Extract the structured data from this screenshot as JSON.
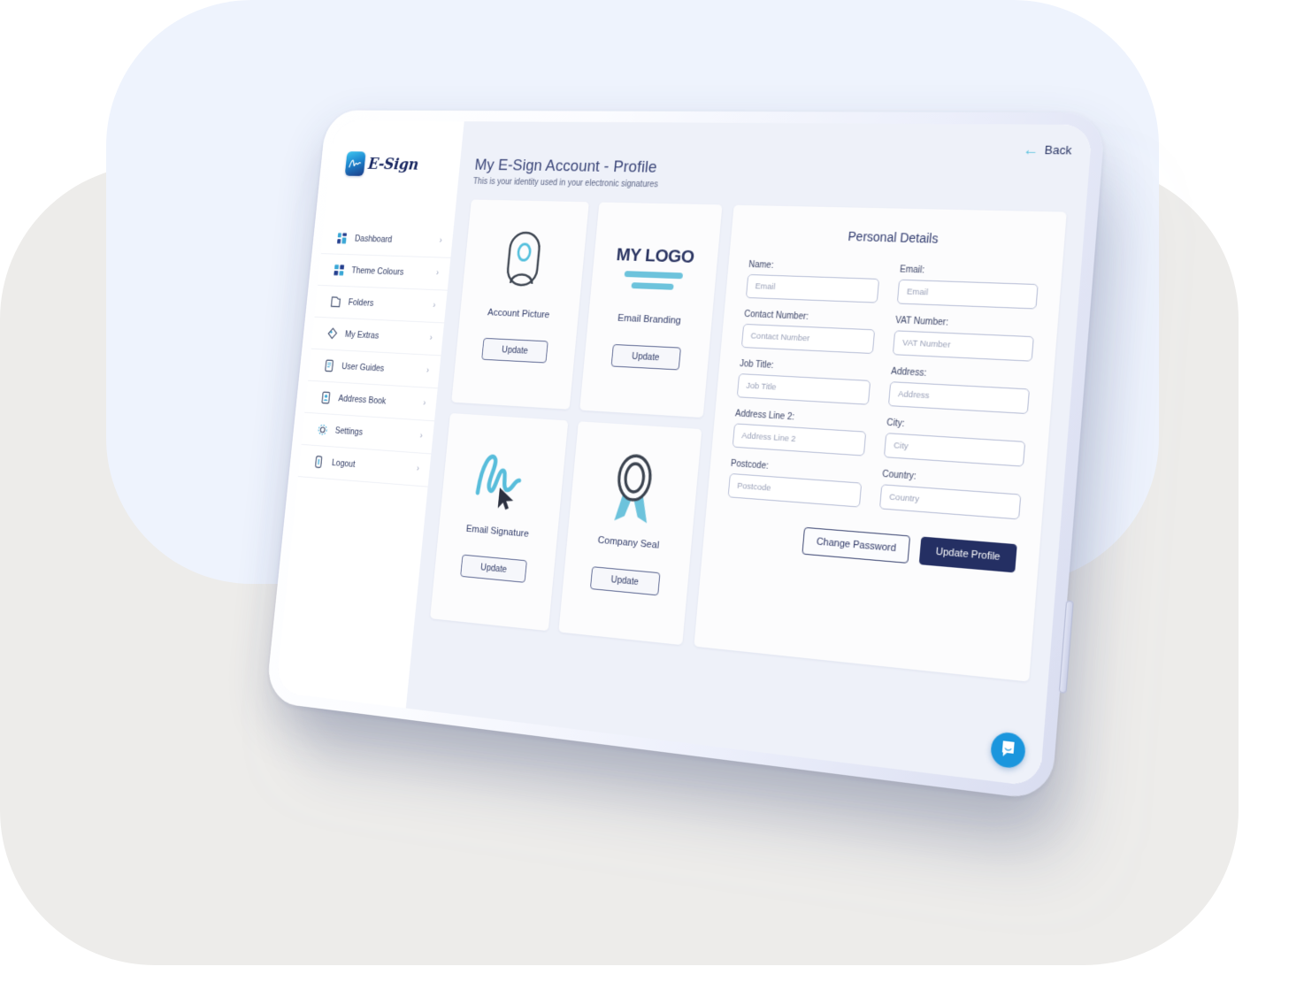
{
  "brand": {
    "name": "E-Sign",
    "mark_icon": "signature-mark-icon"
  },
  "sidebar": {
    "items": [
      {
        "label": "Dashboard",
        "icon": "dashboard-icon",
        "chevron": "›"
      },
      {
        "label": "Theme Colours",
        "icon": "theme-colours-icon",
        "chevron": "›"
      },
      {
        "label": "Folders",
        "icon": "folder-icon",
        "chevron": "›"
      },
      {
        "label": "My Extras",
        "icon": "tag-icon",
        "chevron": "›"
      },
      {
        "label": "User Guides",
        "icon": "guide-book-icon",
        "chevron": "›"
      },
      {
        "label": "Address Book",
        "icon": "address-book-icon",
        "chevron": "›"
      },
      {
        "label": "Settings",
        "icon": "gear-icon",
        "chevron": "›"
      },
      {
        "label": "Logout",
        "icon": "logout-icon",
        "chevron": "›"
      }
    ]
  },
  "header": {
    "back_label": "Back",
    "back_icon": "arrow-left-icon",
    "title": "My E-Sign Account - Profile",
    "subtitle": "This is your identity used in your electronic signatures"
  },
  "cards": [
    {
      "title": "Account Picture",
      "art": "avatar-icon",
      "button": "Update"
    },
    {
      "title": "Email Branding",
      "art": "my-logo-art",
      "logo_text": "MY LOGO",
      "button": "Update"
    },
    {
      "title": "Email Signature",
      "art": "signature-icon",
      "button": "Update"
    },
    {
      "title": "Company Seal",
      "art": "seal-rosette-icon",
      "button": "Update"
    }
  ],
  "details": {
    "title": "Personal Details",
    "fields": [
      {
        "label": "Name:",
        "placeholder": "Email",
        "value": ""
      },
      {
        "label": "Email:",
        "placeholder": "Email",
        "value": ""
      },
      {
        "label": "Contact Number:",
        "placeholder": "Contact Number",
        "value": ""
      },
      {
        "label": "VAT Number:",
        "placeholder": "VAT Number",
        "value": ""
      },
      {
        "label": "Job Title:",
        "placeholder": "Job Title",
        "value": ""
      },
      {
        "label": "Address:",
        "placeholder": "Address",
        "value": ""
      },
      {
        "label": "Address Line 2:",
        "placeholder": "Address Line 2",
        "value": ""
      },
      {
        "label": "City:",
        "placeholder": "City",
        "value": ""
      },
      {
        "label": "Postcode:",
        "placeholder": "Postcode",
        "value": ""
      },
      {
        "label": "Country:",
        "placeholder": "Country",
        "value": ""
      }
    ],
    "change_password_label": "Change Password",
    "update_profile_label": "Update Profile"
  },
  "chat": {
    "icon": "chat-bubble-icon"
  },
  "colors": {
    "accent_teal": "#6dc3dc",
    "accent_blue": "#1b96dd",
    "navy": "#242f63",
    "canvas": "#eef1f9",
    "blob_blue": "#eef3fd",
    "blob_grey": "#edecea"
  }
}
